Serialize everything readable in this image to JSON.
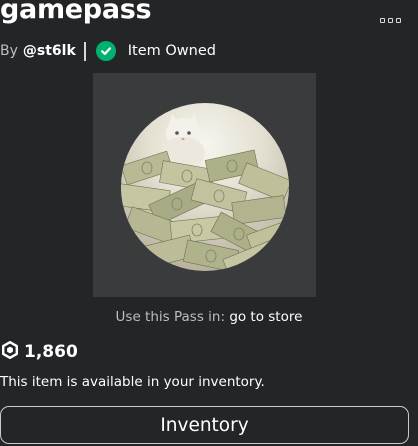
{
  "item": {
    "title": "gamepass",
    "by_label": "By",
    "creator": "@st6lk",
    "owned_label": "Item Owned"
  },
  "use_pass": {
    "label": "Use this Pass in:",
    "link": "go to store"
  },
  "price": {
    "value": "1,860",
    "icon": "robux-icon"
  },
  "availability_text": "This item is available in your inventory.",
  "inventory_button_label": "Inventory",
  "icons": {
    "owned": "checkmark-circle-icon",
    "menu": "more-options-icon"
  },
  "colors": {
    "background": "#232527",
    "thumbnail_bg": "#393b3d",
    "owned_green": "#00b06f"
  }
}
